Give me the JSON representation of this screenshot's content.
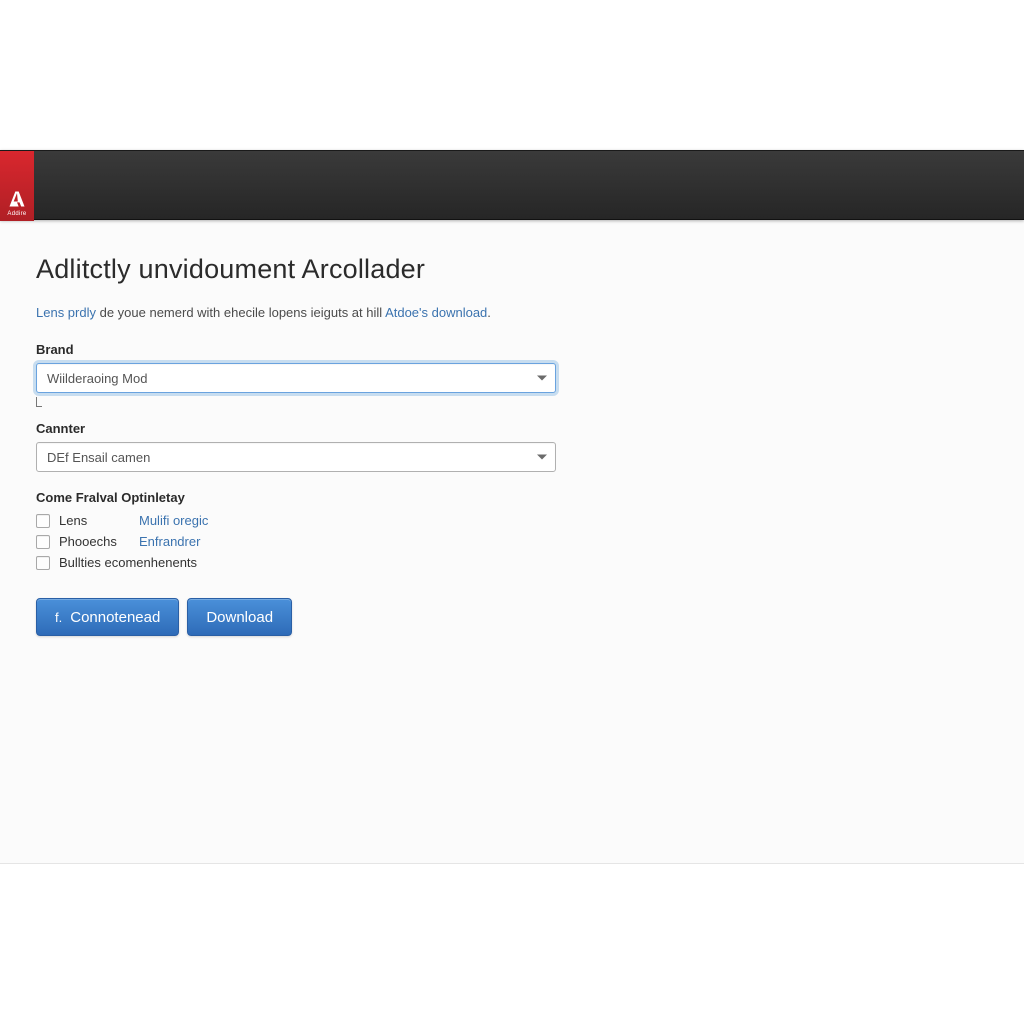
{
  "brand": {
    "logo_label": "Addire"
  },
  "page": {
    "title": "Adlitctly unvidoument Arcollader",
    "subtext_lead": "Lens prdly",
    "subtext_mid": " de youe nemerd with ehecile lopens ieiguts at hill ",
    "subtext_link": "Atdoe's download",
    "subtext_tail": "."
  },
  "form": {
    "brand": {
      "label": "Brand",
      "value": "Wiilderaoing Mod"
    },
    "cannter": {
      "label": "Cannter",
      "value": "DEf Ensail camen"
    },
    "options": {
      "heading": "Come Fralval Optinletay",
      "items": [
        {
          "label": "Lens",
          "link": "Mulifi oregic",
          "checked": false
        },
        {
          "label": "Phooechs",
          "link": "Enfrandrer",
          "checked": false
        },
        {
          "label": "Bullties ecomenhenents",
          "link": "",
          "checked": false
        }
      ]
    }
  },
  "buttons": {
    "primary_icon": "f.",
    "primary": "Connotenead",
    "secondary": "Download"
  }
}
